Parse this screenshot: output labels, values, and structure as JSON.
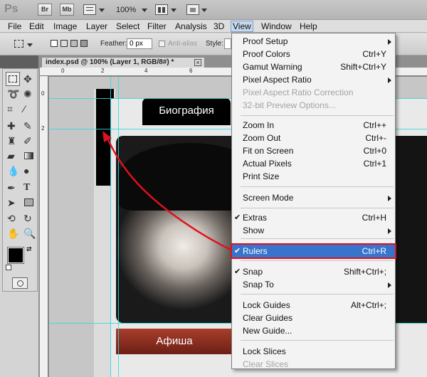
{
  "app": {
    "logo": "Ps",
    "buttons": [
      "Br",
      "Mb"
    ],
    "zoom": "100%"
  },
  "menubar": [
    "File",
    "Edit",
    "Image",
    "Layer",
    "Select",
    "Filter",
    "Analysis",
    "3D",
    "View",
    "Window",
    "Help"
  ],
  "options": {
    "feather_label": "Feather:",
    "feather_value": "0 px",
    "antialias_label": "Anti-alias",
    "style_label": "Style:"
  },
  "document": {
    "tab_title": "index.psd @ 100% (Layer 1, RGB/8#) *",
    "close_glyph": "×",
    "ruler_marks": [
      "0",
      "2",
      "4",
      "6"
    ],
    "ruler_left_marks": [
      "0",
      "2"
    ]
  },
  "canvas_text": {
    "tab_top": "Биография",
    "tab_bottom": "Афиша"
  },
  "view_menu": {
    "items": [
      {
        "label": "Proof Setup",
        "shortcut": "",
        "submenu": true
      },
      {
        "label": "Proof Colors",
        "shortcut": "Ctrl+Y"
      },
      {
        "label": "Gamut Warning",
        "shortcut": "Shift+Ctrl+Y"
      },
      {
        "label": "Pixel Aspect Ratio",
        "shortcut": "",
        "submenu": true
      },
      {
        "label": "Pixel Aspect Ratio Correction",
        "shortcut": "",
        "disabled": true
      },
      {
        "label": "32-bit Preview Options...",
        "shortcut": "",
        "disabled": true
      },
      {
        "label": "Zoom In",
        "shortcut": "Ctrl++"
      },
      {
        "label": "Zoom Out",
        "shortcut": "Ctrl+-"
      },
      {
        "label": "Fit on Screen",
        "shortcut": "Ctrl+0"
      },
      {
        "label": "Actual Pixels",
        "shortcut": "Ctrl+1"
      },
      {
        "label": "Print Size",
        "shortcut": ""
      },
      {
        "label": "Screen Mode",
        "shortcut": "",
        "submenu": true
      },
      {
        "label": "Extras",
        "shortcut": "Ctrl+H",
        "checked": true
      },
      {
        "label": "Show",
        "shortcut": "",
        "submenu": true
      },
      {
        "label": "Rulers",
        "shortcut": "Ctrl+R",
        "checked": true,
        "highlighted": true
      },
      {
        "label": "Snap",
        "shortcut": "Shift+Ctrl+;",
        "checked": true
      },
      {
        "label": "Snap To",
        "shortcut": "",
        "submenu": true
      },
      {
        "label": "Lock Guides",
        "shortcut": "Alt+Ctrl+;"
      },
      {
        "label": "Clear Guides",
        "shortcut": ""
      },
      {
        "label": "New Guide...",
        "shortcut": ""
      },
      {
        "label": "Lock Slices",
        "shortcut": ""
      },
      {
        "label": "Clear Slices",
        "shortcut": "",
        "disabled": true
      }
    ]
  },
  "colors": {
    "highlight": "#3874cc",
    "annotation": "#e0101e",
    "guide": "#2fd9dd",
    "site_tab": "#8e2a1f"
  },
  "checkmark": "✔"
}
